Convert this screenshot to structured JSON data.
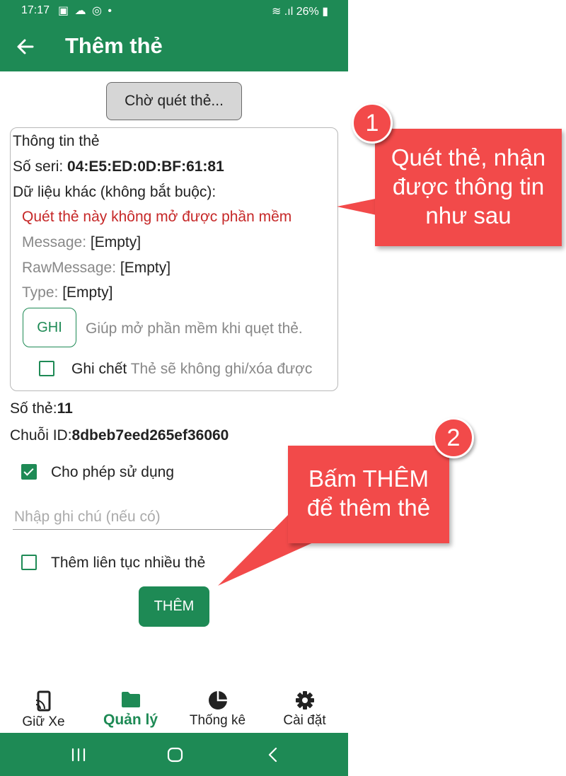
{
  "status_bar": {
    "time": "17:17",
    "battery": "26%"
  },
  "app_bar": {
    "title": "Thêm thẻ"
  },
  "scan_button": {
    "label": "Chờ quét thẻ..."
  },
  "card_info": {
    "heading": "Thông tin thẻ",
    "serial_label": "Số seri:",
    "serial_value": "04:E5:ED:0D:BF:61:81",
    "other_data_label": "Dữ liệu khác (không bắt buộc):",
    "warning": "Quét thẻ này không mở được phần mềm",
    "message_label": "Message:",
    "message_value": "[Empty]",
    "raw_message_label": "RawMessage:",
    "raw_message_value": "[Empty]",
    "type_label": "Type:",
    "type_value": "[Empty]",
    "write_button": "GHI",
    "write_hint": "Giúp mở phần mềm khi quẹt thẻ.",
    "lock_label": "Ghi chết",
    "lock_hint": "Thẻ sẽ không ghi/xóa được",
    "lock_checked": false
  },
  "card_number_label": "Số thẻ:",
  "card_number_value": "11",
  "id_string_label": "Chuỗi ID:",
  "id_string_value": "8dbeb7eed265ef36060",
  "allow_use": {
    "label": "Cho phép sử dụng",
    "checked": true
  },
  "note_input": {
    "placeholder": "Nhập ghi chú (nếu có)",
    "value": ""
  },
  "continuous_add": {
    "label": "Thêm liên tục nhiều thẻ",
    "checked": false
  },
  "add_button": {
    "label": "THÊM"
  },
  "bottom_nav": [
    {
      "label": "Giữ Xe",
      "icon": "phone-nfc-icon",
      "active": false
    },
    {
      "label": "Quản lý",
      "icon": "folder-icon",
      "active": true
    },
    {
      "label": "Thống kê",
      "icon": "pie-chart-icon",
      "active": false
    },
    {
      "label": "Cài đặt",
      "icon": "gear-icon",
      "active": false
    }
  ],
  "callouts": [
    {
      "number": "1",
      "lines": [
        "Quét thẻ, nhận",
        "được thông tin",
        "như sau"
      ]
    },
    {
      "number": "2",
      "lines": [
        "Bấm THÊM",
        "để thêm thẻ"
      ]
    }
  ],
  "colors": {
    "primary": "#1e8a55",
    "callout": "#f24a4a",
    "warning": "#c62828"
  }
}
